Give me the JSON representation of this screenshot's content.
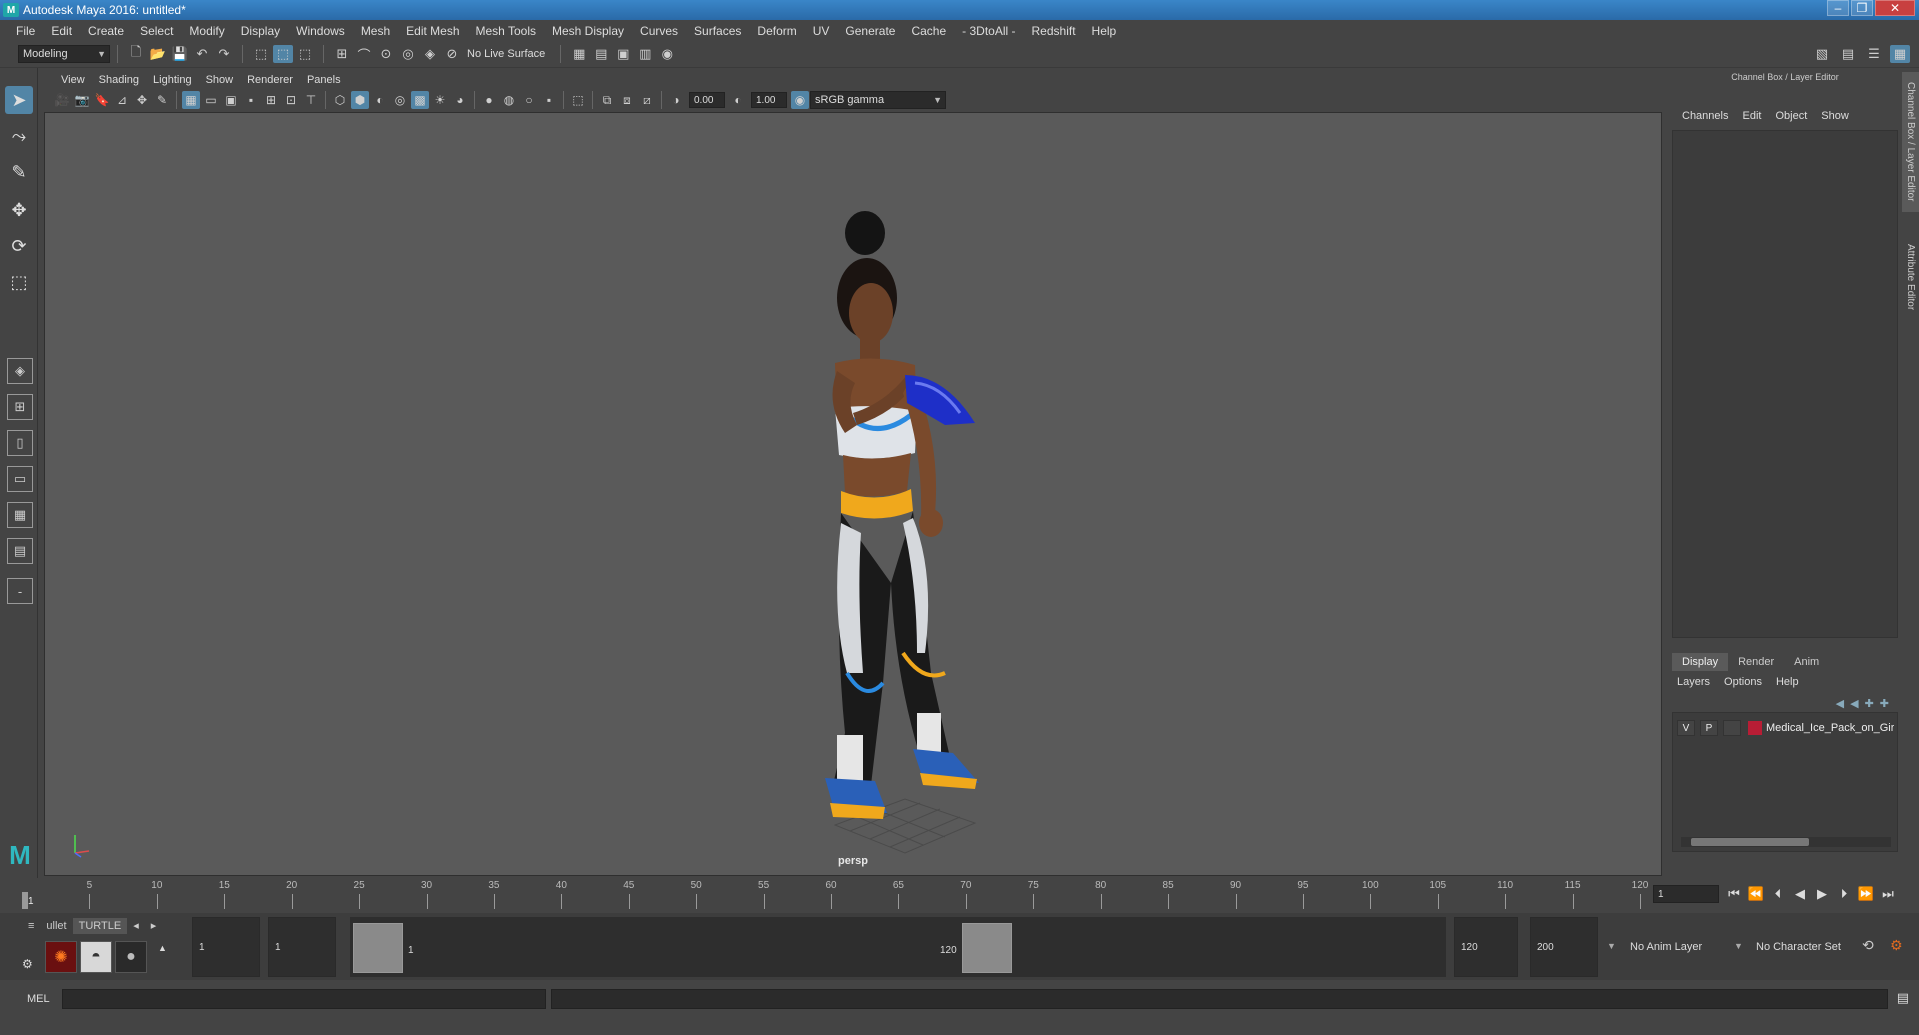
{
  "window": {
    "title": "Autodesk Maya 2016: untitled*",
    "logo": "M",
    "minimize": "–",
    "restore": "❐",
    "close": "✕"
  },
  "menubar": [
    "File",
    "Edit",
    "Create",
    "Select",
    "Modify",
    "Display",
    "Windows",
    "Mesh",
    "Edit Mesh",
    "Mesh Tools",
    "Mesh Display",
    "Curves",
    "Surfaces",
    "Deform",
    "UV",
    "Generate",
    "Cache",
    "- 3DtoAll -",
    "Redshift",
    "Help"
  ],
  "statusline": {
    "menuset": "Modeling",
    "live_surface": "No Live Surface"
  },
  "panel": {
    "menu": [
      "View",
      "Shading",
      "Lighting",
      "Show",
      "Renderer",
      "Panels"
    ],
    "exposure": "0.00",
    "gamma": "1.00",
    "colorspace": "sRGB gamma",
    "camera_label": "persp"
  },
  "channelbox": {
    "title": "Channel Box / Layer Editor",
    "menu": [
      "Channels",
      "Edit",
      "Object",
      "Show"
    ],
    "layer_tabs": [
      "Display",
      "Render",
      "Anim"
    ],
    "layer_menu": [
      "Layers",
      "Options",
      "Help"
    ],
    "layers": [
      {
        "v": "V",
        "p": "P",
        "name": "Medical_Ice_Pack_on_Gir",
        "color": "#b81d35"
      }
    ]
  },
  "side_tabs": [
    "Channel Box / Layer Editor",
    "Attribute Editor"
  ],
  "timeslider": {
    "ticks": [
      5,
      10,
      15,
      20,
      25,
      30,
      35,
      40,
      45,
      50,
      55,
      60,
      65,
      70,
      75,
      80,
      85,
      90,
      95,
      100,
      105,
      110,
      115,
      120
    ],
    "max": 120,
    "current_frame": "1",
    "current_frame_field": "1"
  },
  "rangeslider": {
    "shelf_tabs": [
      "ullet",
      "TURTLE"
    ],
    "start_frame": "1",
    "playback_start": "1",
    "range_start_label": "1",
    "range_end_label": "120",
    "playback_end": "120",
    "end_frame": "200",
    "anim_layer": "No Anim Layer",
    "character_set": "No Character Set"
  },
  "cmdline": {
    "label": "MEL"
  }
}
